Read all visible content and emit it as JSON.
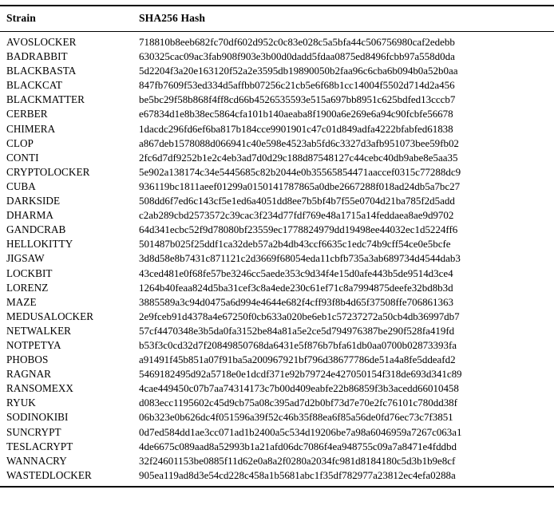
{
  "table": {
    "headers": [
      "Strain",
      "SHA256 Hash"
    ],
    "rows": [
      {
        "strain": "AVOSLOCKER",
        "hash": "718810b8eeb682fc70df602d952c0c83e028c5a5bfa44c506756980caf2edebb"
      },
      {
        "strain": "BADRABBIT",
        "hash": "630325cac09ac3fab908f903e3b00d0dadd5fdaa0875ed8496fcbb97a558d0da"
      },
      {
        "strain": "BLACKBASTA",
        "hash": "5d2204f3a20e163120f52a2e3595db19890050b2faa96c6cba6b094b0a52b0aa"
      },
      {
        "strain": "BLACKCAT",
        "hash": "847fb7609f53ed334d5affbb07256c21cb5e6f68b1cc14004f5502d714d2a456"
      },
      {
        "strain": "BLACKMATTER",
        "hash": "be5bc29f58b868f4ff8cd66b4526535593e515a697bb8951c625bdfed13cccb7"
      },
      {
        "strain": "CERBER",
        "hash": "e67834d1e8b38ec5864cfa101b140aeaba8f1900a6e269e6a94c90fcbfe56678"
      },
      {
        "strain": "CHIMERA",
        "hash": "1dacdc296fd6ef6ba817b184cce9901901c47c01d849adfa4222bfabfed61838"
      },
      {
        "strain": "CLOP",
        "hash": "a867deb1578088d066941c40e598e4523ab5fd6c3327d3afb951073bee59fb02"
      },
      {
        "strain": "CONTI",
        "hash": "2fc6d7df9252b1e2c4eb3ad7d0d29c188d87548127c44cebc40db9abe8e5aa35"
      },
      {
        "strain": "CRYPTOLOCKER",
        "hash": "5e902a138174c34e5445685c82b2044e0b35565854471aaccef0315c77288dc9"
      },
      {
        "strain": "CUBA",
        "hash": "936119bc1811aeef01299a0150141787865a0dbe2667288f018ad24db5a7bc27"
      },
      {
        "strain": "DARKSIDE",
        "hash": "508dd6f7ed6c143cf5e1ed6a4051dd8ee7b5bf4b7f55e0704d21ba785f2d5add"
      },
      {
        "strain": "DHARMA",
        "hash": "c2ab289cbd2573572c39cac3f234d77fdf769e48a1715a14feddaea8ae9d9702"
      },
      {
        "strain": "GANDCRAB",
        "hash": "64d341ecbc52f9d78080bf23559ec1778824979dd19498ee44032ec1d5224ff6"
      },
      {
        "strain": "HELLOKITTY",
        "hash": "501487b025f25ddf1ca32deb57a2b4db43ccf6635c1edc74b9cff54ce0e5bcfe"
      },
      {
        "strain": "JIGSAW",
        "hash": "3d8d58e8b7431c871121c2d3669f68054eda11cbfb735a3ab689734d4544dab3"
      },
      {
        "strain": "LOCKBIT",
        "hash": "43ced481e0f68fe57be3246cc5aede353c9d34f4e15d0afe443b5de9514d3ce4"
      },
      {
        "strain": "LORENZ",
        "hash": "1264b40feaa824d5ba31cef3c8a4ede230c61ef71c8a7994875deefe32bd8b3d"
      },
      {
        "strain": "MAZE",
        "hash": "3885589a3c94d0475a6d994e4644e682f4cff93f8b4d65f37508ffe706861363"
      },
      {
        "strain": "MEDUSALOCKER",
        "hash": "2e9fceb91d4378a4e67250f0cb633a020be6eb1c57237272a50cb4db36997db7"
      },
      {
        "strain": "NETWALKER",
        "hash": "57cf4470348e3b5da0fa3152be84a81a5e2ce5d794976387be290f528fa419fd"
      },
      {
        "strain": "NOTPETYA",
        "hash": "b53f3c0cd32d7f20849850768da6431e5f876b7bfa61db0aa0700b02873393fa"
      },
      {
        "strain": "PHOBOS",
        "hash": "a91491f45b851a07f91ba5a200967921bf796d38677786de51a4a8fe5ddeafd2"
      },
      {
        "strain": "RAGNAR",
        "hash": "5469182495d92a5718e0e1dcdf371e92b79724e427050154f318de693d341c89"
      },
      {
        "strain": "RANSOMEXX",
        "hash": "4cae449450c07b7aa74314173c7b00d409eabfe22b86859f3b3acedd66010458"
      },
      {
        "strain": "RYUK",
        "hash": "d083ecc1195602c45d9cb75a08c395ad7d2b0bf73d7e70e2fc76101c780dd38f"
      },
      {
        "strain": "SODINOKIBI",
        "hash": "06b323e0b626dc4f051596a39f52c46b35f88ea6f85a56de0fd76ec73c7f3851"
      },
      {
        "strain": "SUNCRYPT",
        "hash": "0d7ed584dd1ae3cc071ad1b2400a5c534d19206be7a98a6046959a7267c063a1"
      },
      {
        "strain": "TESLACRYPT",
        "hash": "4de6675c089aad8a52993b1a21afd06dc7086f4ea948755c09a7a8471e4fddbd"
      },
      {
        "strain": "WANNACRY",
        "hash": "32f24601153be0885f11d62e0a8a2f0280a2034fc981d8184180c5d3b1b9e8cf"
      },
      {
        "strain": "WASTEDLOCKER",
        "hash": "905ea119ad8d3e54cd228c458a1b5681abc1f35df782977a23812ec4efa0288a"
      }
    ]
  }
}
